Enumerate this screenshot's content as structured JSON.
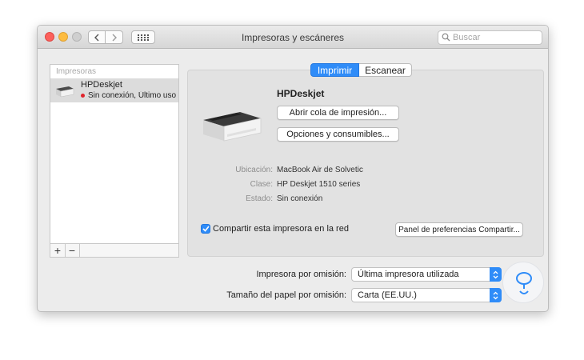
{
  "window": {
    "title": "Impresoras y escáneres",
    "search_placeholder": "Buscar"
  },
  "sidebar": {
    "header": "Impresoras",
    "printers": [
      {
        "name": "HPDeskjet",
        "status": "Sin conexión, Último uso",
        "status_color": "#e0232b"
      }
    ],
    "add_label": "+",
    "remove_label": "−"
  },
  "tabs": [
    {
      "label": "Imprimir",
      "selected": true
    },
    {
      "label": "Escanear",
      "selected": false
    }
  ],
  "printer": {
    "name": "HPDeskjet",
    "open_queue_button": "Abrir cola de impresión...",
    "options_button": "Opciones y consumibles...",
    "info": [
      {
        "label": "Ubicación:",
        "value": "MacBook Air de Solvetic"
      },
      {
        "label": "Clase:",
        "value": "HP Deskjet 1510 series"
      },
      {
        "label": "Estado:",
        "value": "Sin conexión"
      }
    ],
    "share_checkbox_label": "Compartir esta impresora en la red",
    "share_checked": true,
    "sharing_prefs_button": "Panel de preferencias Compartir..."
  },
  "defaults": {
    "default_printer_label": "Impresora por omisión:",
    "default_printer_value": "Última impresora utilizada",
    "paper_size_label": "Tamaño del papel por omisión:",
    "paper_size_value": "Carta (EE.UU.)"
  },
  "colors": {
    "accent": "#2f8cf8",
    "status_offline": "#e0232b"
  }
}
